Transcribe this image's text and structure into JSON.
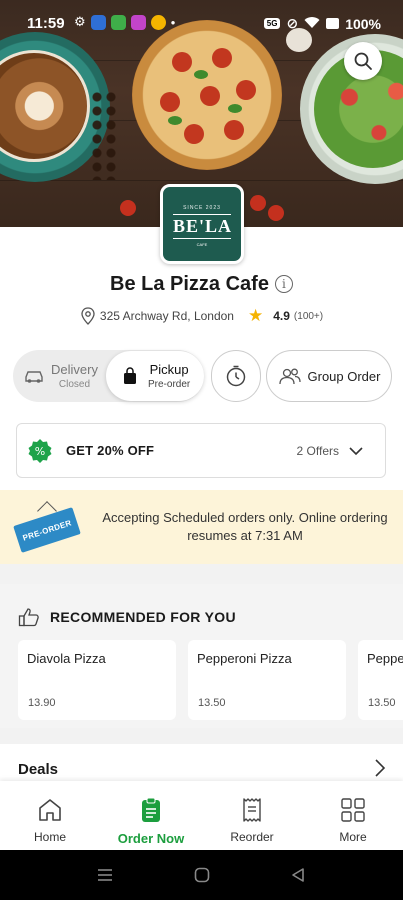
{
  "status_bar": {
    "time": "11:59",
    "battery": "100%",
    "network_tag": "5G"
  },
  "restaurant": {
    "logo_small_text": "SINCE 2023",
    "logo_name": "BE'LA",
    "logo_tiny_text": "CAFE",
    "name": "Be La Pizza Cafe",
    "address": "325 Archway Rd, London",
    "rating": "4.9",
    "rating_count": "(100+)"
  },
  "order_mode": {
    "delivery_label": "Delivery",
    "delivery_status": "Closed",
    "pickup_label": "Pickup",
    "pickup_status": "Pre-order",
    "group_order_label": "Group Order"
  },
  "offer": {
    "title": "GET 20% OFF",
    "count": "2 Offers"
  },
  "banner": {
    "tag": "PRE-ORDER",
    "message": "Accepting Scheduled orders only. Online ordering resumes at 7:31 AM"
  },
  "recommended": {
    "heading": "RECOMMENDED FOR YOU",
    "items": [
      {
        "name": "Diavola Pizza",
        "price": "13.90"
      },
      {
        "name": "Pepperoni Pizza",
        "price": "13.50"
      },
      {
        "name": "Peppe",
        "price": "13.50"
      }
    ]
  },
  "deals": {
    "heading": "Deals"
  },
  "bottom_nav": {
    "items": [
      {
        "label": "Home"
      },
      {
        "label": "Order Now"
      },
      {
        "label": "Reorder"
      },
      {
        "label": "More"
      }
    ],
    "active_color": "#1c9e3e"
  }
}
